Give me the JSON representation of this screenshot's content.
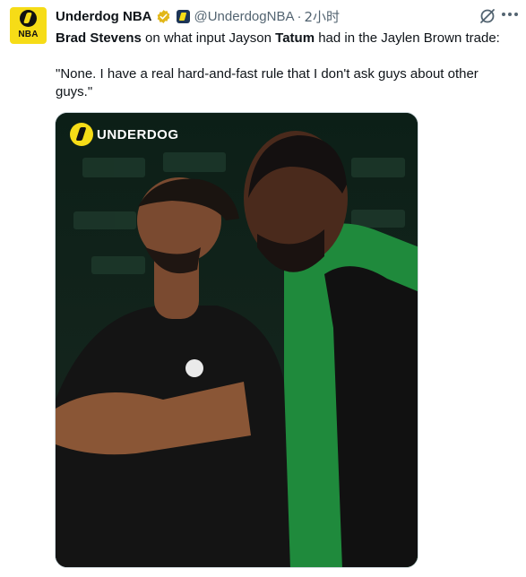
{
  "account": {
    "name": "Underdog NBA",
    "handle": "@UnderdogNBA",
    "separator": "·",
    "time": "2小时",
    "avatar_label": "NBA",
    "verified_icon": "verified-badge-gold",
    "affiliation_icon": "underdog-affiliate-icon"
  },
  "tweet": {
    "part1": "Brad Stevens",
    "part2": " on what input Jayson ",
    "part3": "Tatum",
    "part4": " had in the Jaylen Brown trade:",
    "quote": "\"None. I have a real hard-and-fast rule that I don't ask guys about other guys.\""
  },
  "media": {
    "watermark": "UNDERDOG"
  },
  "icons": {
    "grok": "grok-icon",
    "more": "more-icon"
  },
  "colors": {
    "brand_yellow": "#f6dc17",
    "secondary_text": "#536471",
    "verified_gold": "#e2b719",
    "celtics_green": "#1f8a3c"
  }
}
